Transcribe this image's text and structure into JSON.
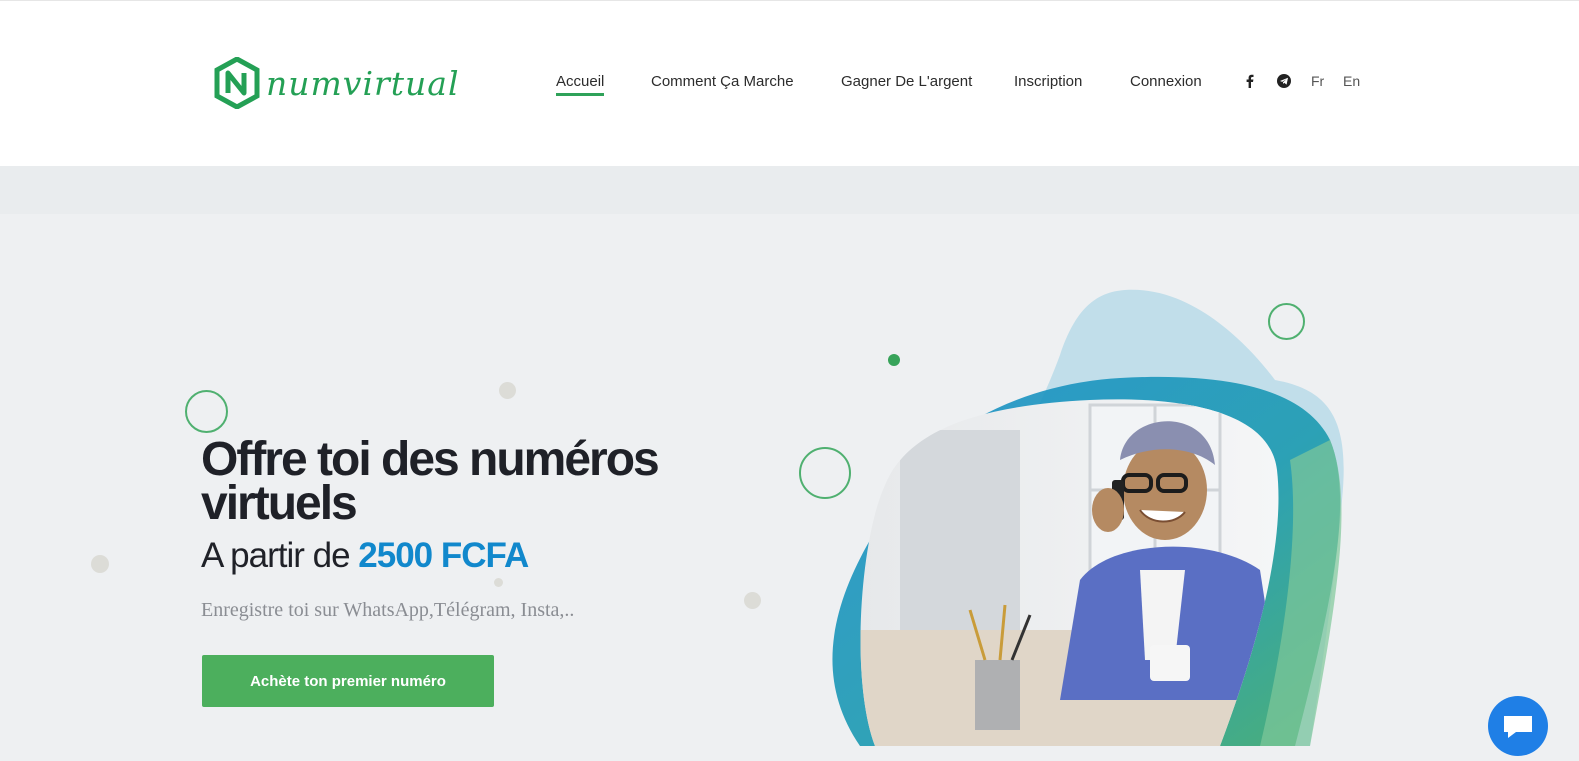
{
  "brand": {
    "name": "numvirtual",
    "color": "#24a055"
  },
  "nav": {
    "items": [
      {
        "label": "Accueil",
        "active": true
      },
      {
        "label": "Comment Ça Marche",
        "active": false
      },
      {
        "label": "Gagner De L'argent",
        "active": false
      },
      {
        "label": "Inscription",
        "active": false
      },
      {
        "label": "Connexion",
        "active": false
      }
    ],
    "social": [
      {
        "icon": "facebook-icon"
      },
      {
        "icon": "telegram-icon"
      }
    ],
    "languages": [
      "Fr",
      "En"
    ]
  },
  "hero": {
    "headline": "Offre toi des numéros virtuels",
    "price_prefix": "A partir de ",
    "price": "2500 FCFA",
    "subtitle": "Enregistre toi sur WhatsApp,Télégram, Insta,..",
    "cta_label": "Achète ton premier numéro",
    "image_icon": "man-on-phone-photo"
  },
  "chat": {
    "icon": "chat-bubble-icon"
  },
  "colors": {
    "accent_green": "#4caf5d",
    "price_blue": "#1188cc",
    "chat_blue": "#1f7fe6"
  }
}
